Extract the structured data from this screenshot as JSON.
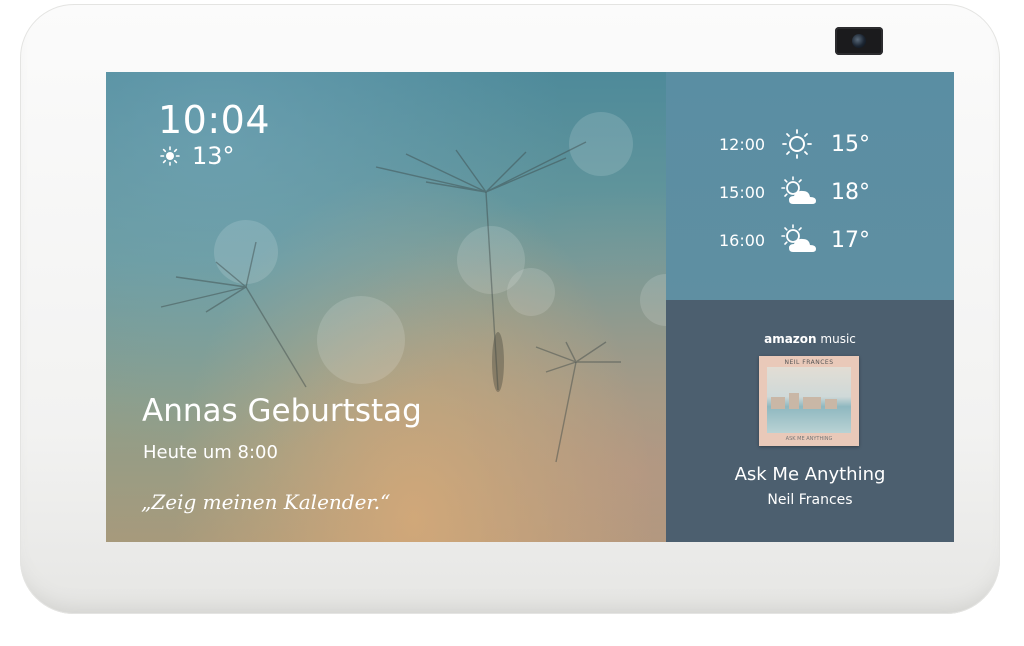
{
  "clock": {
    "time": "10:04"
  },
  "current_weather": {
    "temperature": "13°",
    "icon": "sun-icon"
  },
  "event": {
    "title": "Annas Geburtstag",
    "time": "Heute um 8:00",
    "hint": "„Zeig meinen Kalender.“"
  },
  "forecast": [
    {
      "time": "12:00",
      "temp": "15°",
      "icon": "sun-icon"
    },
    {
      "time": "15:00",
      "temp": "18°",
      "icon": "partly-cloudy-icon"
    },
    {
      "time": "16:00",
      "temp": "17°",
      "icon": "partly-cloudy-icon"
    }
  ],
  "music": {
    "service_brand": "amazon",
    "service_name": "music",
    "album_artist_label": "NEIL FRANCES",
    "album_subtitle": "ASK ME ANYTHING",
    "track": "Ask Me Anything",
    "artist": "Neil Frances"
  },
  "colors": {
    "forecast_bg": "#5a8ea3",
    "music_bg": "#4c5f6f",
    "device_body": "#f4f4f3"
  }
}
